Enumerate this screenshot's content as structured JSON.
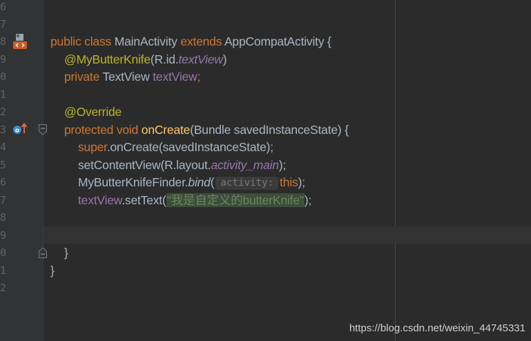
{
  "gutter": {
    "line_numbers": [
      "6",
      "7",
      "8",
      "9",
      "0",
      "1",
      "2",
      "3",
      "4",
      "5",
      "6",
      "7",
      "8",
      "9",
      "0",
      "1",
      "2"
    ]
  },
  "code": {
    "class_decl": {
      "kw": "public class ",
      "name": "MainActivity ",
      "kw2": "extends ",
      "parent": "AppCompatActivity {"
    },
    "ann_field": {
      "ann": "@MyButterKnife",
      "open": "(R.id.",
      "field": "textView",
      "close": ")"
    },
    "field_decl": {
      "kw": "private ",
      "type": "TextView ",
      "name": "textView",
      "semi": ";"
    },
    "override": "@Override",
    "method_decl": {
      "kw": "protected void ",
      "name": "onCreate",
      "params": "(Bundle savedInstanceState) {"
    },
    "super_call": {
      "kw": "super",
      "rest": ".onCreate(savedInstanceState);"
    },
    "set_content": {
      "pre": "setContentView(R.layout.",
      "field": "activity_main",
      "post": ");"
    },
    "bind_call": {
      "cls": "MyButterKnifeFinder.",
      "method": "bind",
      "paren": "(",
      "hint": "activity:",
      "arg": "this",
      "close": ");"
    },
    "set_text": {
      "field": "textView",
      "call": ".setText(",
      "str": "\"我是自定义的butterKnife\"",
      "close": ");"
    },
    "method_close": "}",
    "class_close": "}"
  },
  "watermark": "https://blog.csdn.net/weixin_44745331",
  "colors": {
    "background": "#2b2b2b",
    "keyword": "#cc7832",
    "annotation": "#bbb529",
    "field": "#9876aa",
    "string": "#6a8759",
    "method": "#ffc66d",
    "default": "#a9b7c6"
  }
}
